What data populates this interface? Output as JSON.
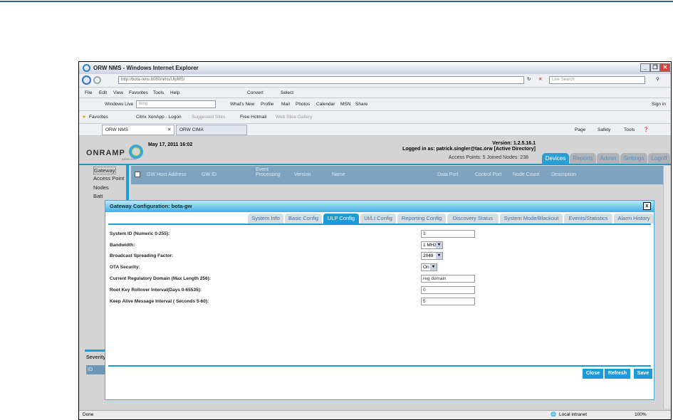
{
  "window": {
    "title": "ORW NMS - Windows Internet Explorer"
  },
  "address": {
    "url": "http://bota-nms:8080/nms/UlpMS/",
    "search_placeholder": "Live Search"
  },
  "menu": [
    "File",
    "Edit",
    "View",
    "Favorites",
    "Tools",
    "Help"
  ],
  "menu_tools": {
    "convert": "Convert",
    "select": "Select"
  },
  "links_bar": {
    "brand": "Windows Live",
    "search_value": "Bing",
    "items": [
      "What's New",
      "Profile",
      "Mail",
      "Photos",
      "Calendar",
      "MSN",
      "Share"
    ],
    "signin": "Sign in"
  },
  "favorites_bar": {
    "favorites": "Favorites",
    "items": [
      "Citrix XenApp - Logon",
      "Suggested Sites",
      "Free Hotmail",
      "Web Slice Gallery"
    ]
  },
  "browser_tabs": [
    {
      "label": "ORW NMS",
      "active": true
    },
    {
      "label": "ORW CIMA",
      "active": false
    }
  ],
  "command_bar": {
    "page": "Page",
    "safety": "Safety",
    "tools": "Tools"
  },
  "app": {
    "logo_text": "ONRAMP",
    "logo_sub": "WIRELESS",
    "datetime": "May 17, 2011 16:02",
    "version": "Version: 1.2.5.16.1",
    "logged_in": "Logged in as: patrick.singler@tac.orw [Active Directory]",
    "stats": "Access Points: 5 Joined Nodes: 238",
    "nav_tabs": [
      {
        "label": "Devices",
        "active": true
      },
      {
        "label": "Reports"
      },
      {
        "label": "Admin"
      },
      {
        "label": "Settings"
      },
      {
        "label": "Logoff"
      }
    ],
    "sidebar": [
      "Gateway",
      "Access Point",
      "Nodes",
      "Batt"
    ],
    "grid_columns": [
      "GW Host Address",
      "GW ID",
      "Event Processing",
      "Version",
      "Name",
      "Data Port",
      "Control Port",
      "Node Count",
      "Description"
    ],
    "severity_label": "Severity",
    "lower_grid_column": "ID",
    "accent": "#1f9ad6"
  },
  "modal": {
    "title": "Gateway Configuration: bota-gw",
    "close_glyph": "x",
    "tabs": [
      {
        "label": "System Info"
      },
      {
        "label": "Basic Config"
      },
      {
        "label": "ULP Config",
        "active": true
      },
      {
        "label": "UI/LI Config"
      },
      {
        "label": "Reporting Config"
      },
      {
        "label": "Discovery Status"
      },
      {
        "label": "System Mode/Blackout"
      },
      {
        "label": "Events/Statistics"
      },
      {
        "label": "Alarm History"
      }
    ],
    "fields": [
      {
        "label": "System ID (Numeric 0-255):",
        "value": "3",
        "type": "text"
      },
      {
        "label": "Bandwidth:",
        "value": "1 MHz",
        "type": "select"
      },
      {
        "label": "Broadcast Spreading Factor:",
        "value": "2048",
        "type": "select"
      },
      {
        "label": "OTA Security:",
        "value": "On",
        "type": "select"
      },
      {
        "label": "Current Regulatory Domain (Max Length 256):",
        "value": "reg domain",
        "type": "text"
      },
      {
        "label": "Root Key Rollover Interval(Days 0-65535):",
        "value": "0",
        "type": "text"
      },
      {
        "label": "Keep Alive Message Interval ( Seconds 5-60):",
        "value": "5",
        "type": "text"
      }
    ],
    "buttons": {
      "close": "Close",
      "refresh": "Refresh",
      "save": "Save"
    }
  },
  "statusbar": {
    "left": "Done",
    "zone": "Local intranet",
    "zoom": "100%"
  }
}
